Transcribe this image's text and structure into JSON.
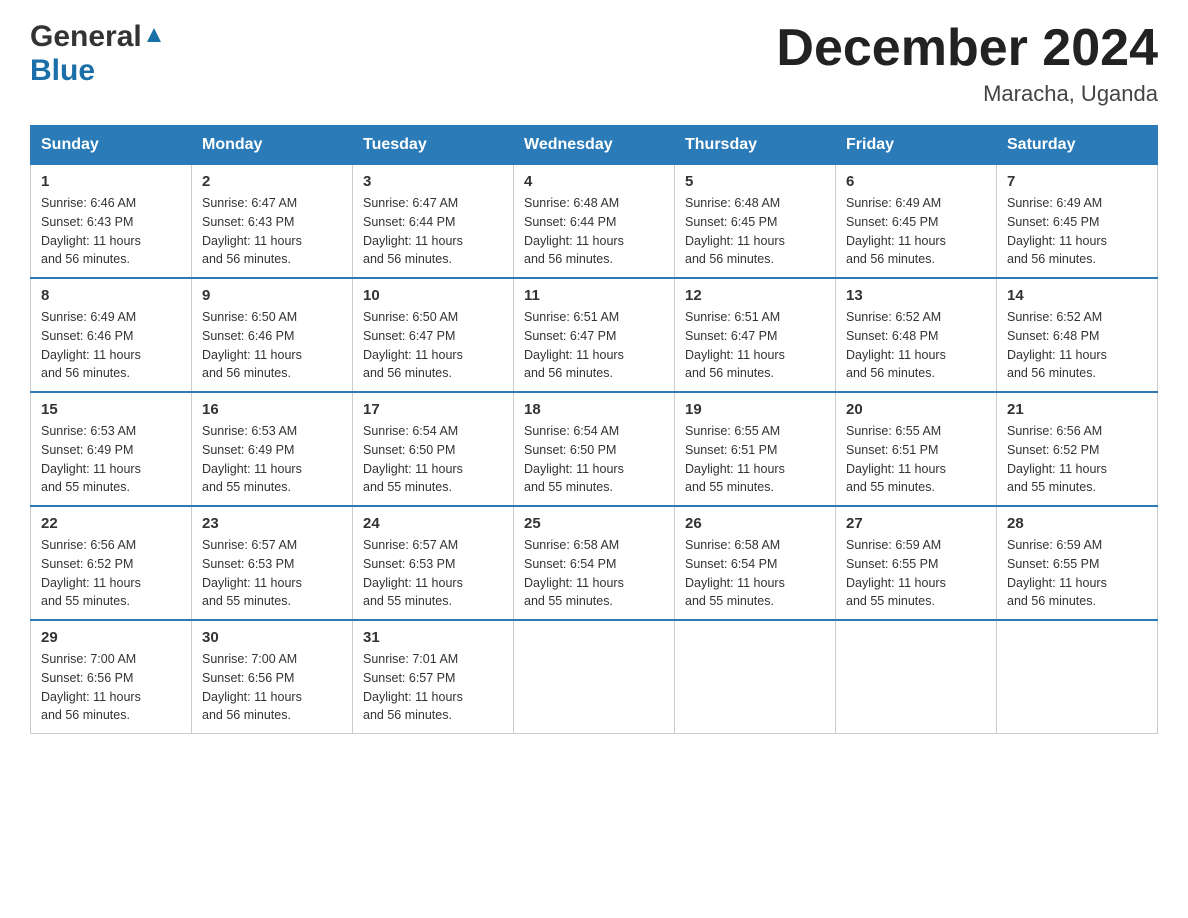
{
  "header": {
    "logo_general": "General",
    "logo_blue": "Blue",
    "month_title": "December 2024",
    "location": "Maracha, Uganda"
  },
  "weekdays": [
    "Sunday",
    "Monday",
    "Tuesday",
    "Wednesday",
    "Thursday",
    "Friday",
    "Saturday"
  ],
  "weeks": [
    [
      {
        "day": "1",
        "sunrise": "6:46 AM",
        "sunset": "6:43 PM",
        "daylight": "11 hours and 56 minutes."
      },
      {
        "day": "2",
        "sunrise": "6:47 AM",
        "sunset": "6:43 PM",
        "daylight": "11 hours and 56 minutes."
      },
      {
        "day": "3",
        "sunrise": "6:47 AM",
        "sunset": "6:44 PM",
        "daylight": "11 hours and 56 minutes."
      },
      {
        "day": "4",
        "sunrise": "6:48 AM",
        "sunset": "6:44 PM",
        "daylight": "11 hours and 56 minutes."
      },
      {
        "day": "5",
        "sunrise": "6:48 AM",
        "sunset": "6:45 PM",
        "daylight": "11 hours and 56 minutes."
      },
      {
        "day": "6",
        "sunrise": "6:49 AM",
        "sunset": "6:45 PM",
        "daylight": "11 hours and 56 minutes."
      },
      {
        "day": "7",
        "sunrise": "6:49 AM",
        "sunset": "6:45 PM",
        "daylight": "11 hours and 56 minutes."
      }
    ],
    [
      {
        "day": "8",
        "sunrise": "6:49 AM",
        "sunset": "6:46 PM",
        "daylight": "11 hours and 56 minutes."
      },
      {
        "day": "9",
        "sunrise": "6:50 AM",
        "sunset": "6:46 PM",
        "daylight": "11 hours and 56 minutes."
      },
      {
        "day": "10",
        "sunrise": "6:50 AM",
        "sunset": "6:47 PM",
        "daylight": "11 hours and 56 minutes."
      },
      {
        "day": "11",
        "sunrise": "6:51 AM",
        "sunset": "6:47 PM",
        "daylight": "11 hours and 56 minutes."
      },
      {
        "day": "12",
        "sunrise": "6:51 AM",
        "sunset": "6:47 PM",
        "daylight": "11 hours and 56 minutes."
      },
      {
        "day": "13",
        "sunrise": "6:52 AM",
        "sunset": "6:48 PM",
        "daylight": "11 hours and 56 minutes."
      },
      {
        "day": "14",
        "sunrise": "6:52 AM",
        "sunset": "6:48 PM",
        "daylight": "11 hours and 56 minutes."
      }
    ],
    [
      {
        "day": "15",
        "sunrise": "6:53 AM",
        "sunset": "6:49 PM",
        "daylight": "11 hours and 55 minutes."
      },
      {
        "day": "16",
        "sunrise": "6:53 AM",
        "sunset": "6:49 PM",
        "daylight": "11 hours and 55 minutes."
      },
      {
        "day": "17",
        "sunrise": "6:54 AM",
        "sunset": "6:50 PM",
        "daylight": "11 hours and 55 minutes."
      },
      {
        "day": "18",
        "sunrise": "6:54 AM",
        "sunset": "6:50 PM",
        "daylight": "11 hours and 55 minutes."
      },
      {
        "day": "19",
        "sunrise": "6:55 AM",
        "sunset": "6:51 PM",
        "daylight": "11 hours and 55 minutes."
      },
      {
        "day": "20",
        "sunrise": "6:55 AM",
        "sunset": "6:51 PM",
        "daylight": "11 hours and 55 minutes."
      },
      {
        "day": "21",
        "sunrise": "6:56 AM",
        "sunset": "6:52 PM",
        "daylight": "11 hours and 55 minutes."
      }
    ],
    [
      {
        "day": "22",
        "sunrise": "6:56 AM",
        "sunset": "6:52 PM",
        "daylight": "11 hours and 55 minutes."
      },
      {
        "day": "23",
        "sunrise": "6:57 AM",
        "sunset": "6:53 PM",
        "daylight": "11 hours and 55 minutes."
      },
      {
        "day": "24",
        "sunrise": "6:57 AM",
        "sunset": "6:53 PM",
        "daylight": "11 hours and 55 minutes."
      },
      {
        "day": "25",
        "sunrise": "6:58 AM",
        "sunset": "6:54 PM",
        "daylight": "11 hours and 55 minutes."
      },
      {
        "day": "26",
        "sunrise": "6:58 AM",
        "sunset": "6:54 PM",
        "daylight": "11 hours and 55 minutes."
      },
      {
        "day": "27",
        "sunrise": "6:59 AM",
        "sunset": "6:55 PM",
        "daylight": "11 hours and 55 minutes."
      },
      {
        "day": "28",
        "sunrise": "6:59 AM",
        "sunset": "6:55 PM",
        "daylight": "11 hours and 56 minutes."
      }
    ],
    [
      {
        "day": "29",
        "sunrise": "7:00 AM",
        "sunset": "6:56 PM",
        "daylight": "11 hours and 56 minutes."
      },
      {
        "day": "30",
        "sunrise": "7:00 AM",
        "sunset": "6:56 PM",
        "daylight": "11 hours and 56 minutes."
      },
      {
        "day": "31",
        "sunrise": "7:01 AM",
        "sunset": "6:57 PM",
        "daylight": "11 hours and 56 minutes."
      },
      null,
      null,
      null,
      null
    ]
  ],
  "labels": {
    "sunrise": "Sunrise:",
    "sunset": "Sunset:",
    "daylight": "Daylight:"
  }
}
